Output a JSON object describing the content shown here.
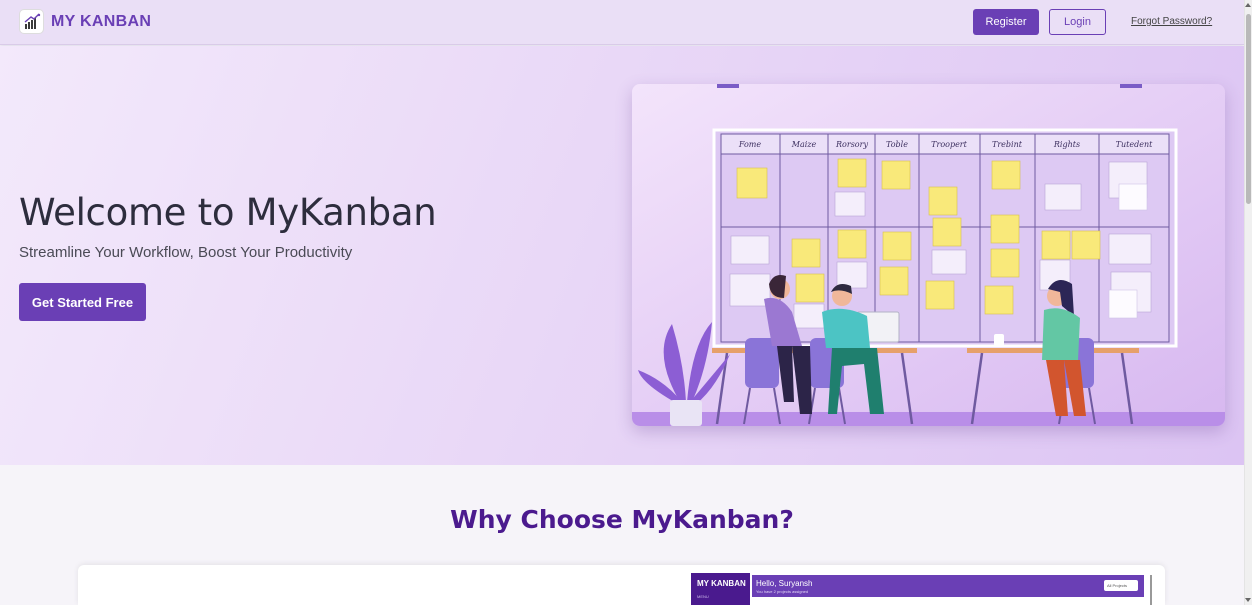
{
  "header": {
    "brand": "MY KANBAN",
    "register_label": "Register",
    "login_label": "Login",
    "forgot_label": "Forgot Password?"
  },
  "hero": {
    "title": "Welcome to MyKanban",
    "subtitle": "Streamline Your Workflow, Boost Your Productivity",
    "cta_label": "Get Started Free",
    "board_columns": [
      "Fome",
      "Maize",
      "Rorsory",
      "Toble",
      "Troopert",
      "Trebint",
      "Rights",
      "Tutedent"
    ]
  },
  "why": {
    "title": "Why Choose MyKanban?"
  },
  "preview": {
    "brand": "MY KANBAN",
    "menu": "MENU",
    "greeting": "Hello, Suryansh",
    "note": "You have 2 projects assigned",
    "select": "All Projects"
  },
  "colors": {
    "primary": "#6a3fb5",
    "heading": "#4b1a8e",
    "header_bg": "#eadff6"
  }
}
